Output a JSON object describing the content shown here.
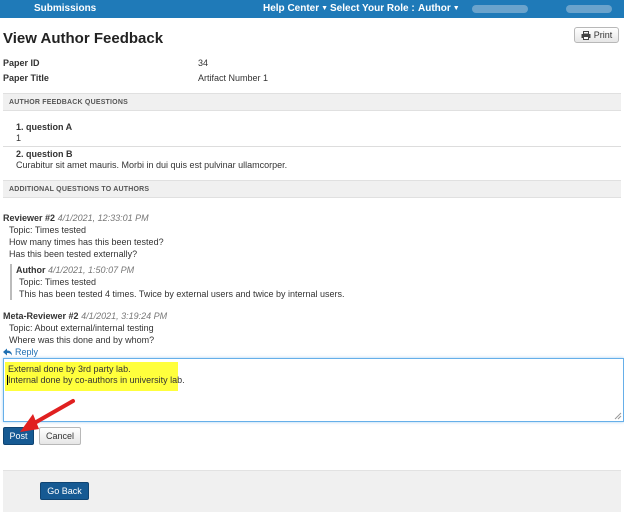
{
  "topbar": {
    "submissions": "Submissions",
    "help_center": "Help Center",
    "select_role_label": "Select Your Role :",
    "role": "Author"
  },
  "header": {
    "title": "View Author Feedback",
    "print_label": "Print"
  },
  "paper": {
    "id_label": "Paper ID",
    "id_value": "34",
    "title_label": "Paper Title",
    "title_value": "Artifact Number 1"
  },
  "feedback_section": {
    "heading": "AUTHOR FEEDBACK QUESTIONS",
    "questions": [
      {
        "title": "1. question A",
        "answer": "1"
      },
      {
        "title": "2. question B",
        "answer": "Curabitur sit amet mauris. Morbi in dui quis est pulvinar ullamcorper."
      }
    ]
  },
  "additional_section": {
    "heading": "ADDITIONAL QUESTIONS TO AUTHORS",
    "threads": [
      {
        "author": "Reviewer #2",
        "timestamp": "4/1/2021, 12:33:01 PM",
        "topic": "Topic: Times tested",
        "lines": [
          "How many times has this been tested?",
          "Has this been tested externally?"
        ],
        "reply": {
          "author": "Author",
          "timestamp": "4/1/2021, 1:50:07 PM",
          "topic": "Topic: Times tested",
          "lines": [
            "This has been tested 4 times. Twice by external users and twice by internal users."
          ]
        }
      },
      {
        "author": "Meta-Reviewer #2",
        "timestamp": "4/1/2021, 3:19:24 PM",
        "topic": "Topic: About external/internal testing",
        "lines": [
          "Where was this done and by whom?"
        ]
      }
    ],
    "reply_link": "Reply",
    "reply_text": [
      "External done by 3rd party lab.",
      "Internal done by co-authors in university lab."
    ],
    "post_label": "Post",
    "cancel_label": "Cancel"
  },
  "footer": {
    "go_back_label": "Go Back"
  },
  "colors": {
    "topbar": "#1f7ab8",
    "primary_button": "#165a93",
    "highlight": "#ffff3c",
    "annotation_arrow": "#e02020"
  }
}
